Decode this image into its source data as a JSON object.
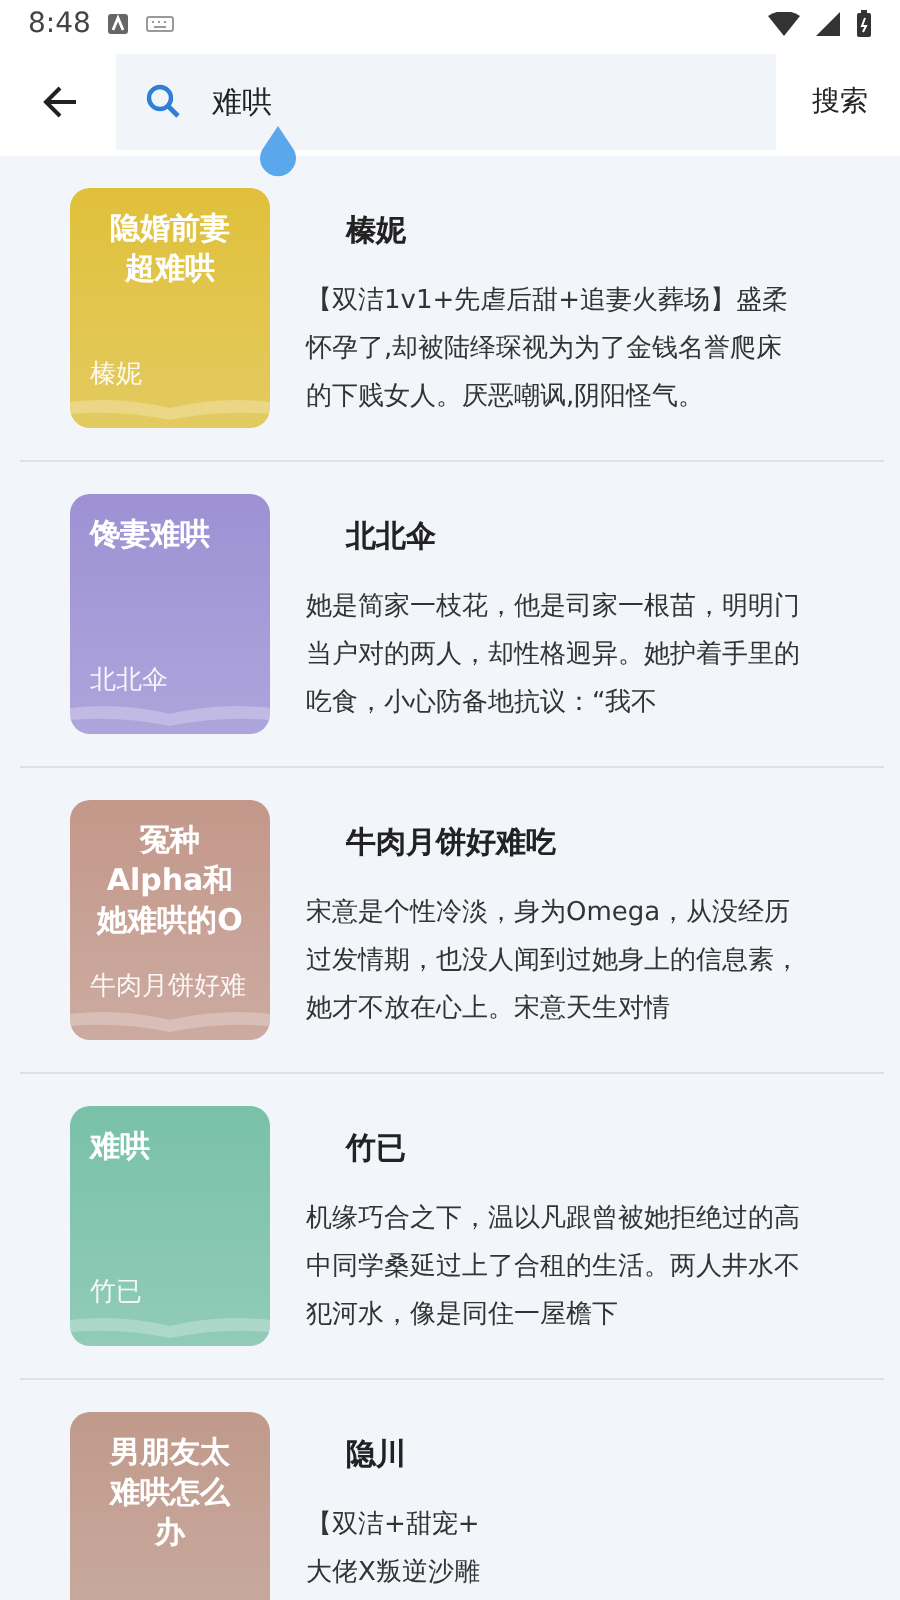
{
  "status_bar": {
    "time": "8:48"
  },
  "search": {
    "value": "难哄",
    "button": "搜索"
  },
  "results": [
    {
      "cover": {
        "title_lines": [
          "隐婚前妻",
          "超难哄"
        ],
        "author": "榛妮",
        "color": "#e0c03a"
      },
      "author": "榛妮",
      "description": "【双洁1v1+先虐后甜+追妻火葬场】盛柔怀孕了,却被陆绎琛视为为了金钱名誉爬床的下贱女人。厌恶嘲讽,阴阳怪气。"
    },
    {
      "cover": {
        "title_lines": [
          "馋妻难哄"
        ],
        "author": "北北伞",
        "color": "#9d91d4"
      },
      "author": "北北伞",
      "description": "她是简家一枝花，他是司家一根苗，明明门当户对的两人，却性格迥异。她护着手里的吃食，小心防备地抗议：“我不"
    },
    {
      "cover": {
        "title_lines": [
          "冤种",
          "Alpha和",
          "她难哄的O"
        ],
        "author": "牛肉月饼好难",
        "color": "#c3988a"
      },
      "author": "牛肉月饼好难吃",
      "description": "宋意是个性冷淡，身为Omega，从没经历过发情期，也没人闻到过她身上的信息素，她才不放在心上。宋意天生对情"
    },
    {
      "cover": {
        "title_lines": [
          "难哄"
        ],
        "author": "竹已",
        "color": "#79c1a8"
      },
      "author": "竹已",
      "description": "机缘巧合之下，温以凡跟曾被她拒绝过的高中同学桑延过上了合租的生活。两人井水不犯河水，像是同住一屋檐下"
    },
    {
      "cover": {
        "title_lines": [
          "男朋友太",
          "难哄怎么",
          "办"
        ],
        "color": "#c09a8b"
      },
      "author": "隐川",
      "description": "【双洁+甜宠+\n大佬X叛逆沙雕"
    }
  ]
}
